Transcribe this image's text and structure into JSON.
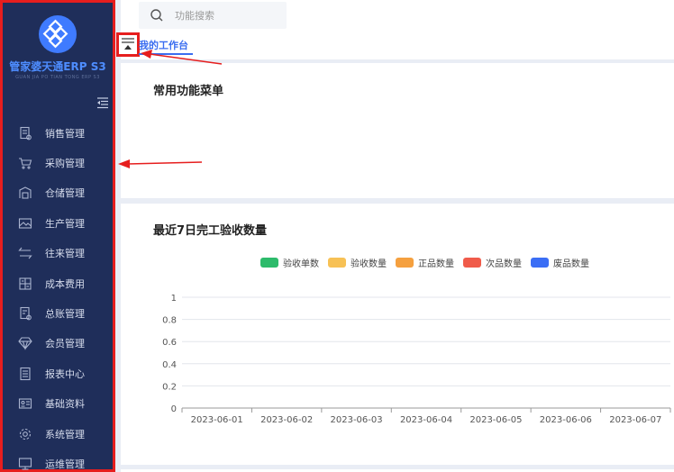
{
  "brand": {
    "name": "管家婆天通ERP S3",
    "subtitle": "GUAN JIA PO TIAN TONG ERP S3"
  },
  "sidebar": {
    "items": [
      {
        "label": "销售管理",
        "icon": "sales-doc-icon"
      },
      {
        "label": "采购管理",
        "icon": "cart-icon"
      },
      {
        "label": "仓储管理",
        "icon": "warehouse-icon"
      },
      {
        "label": "生产管理",
        "icon": "factory-icon"
      },
      {
        "label": "往来管理",
        "icon": "exchange-icon"
      },
      {
        "label": "成本费用",
        "icon": "calculator-icon"
      },
      {
        "label": "总账管理",
        "icon": "ledger-icon"
      },
      {
        "label": "会员管理",
        "icon": "diamond-icon"
      },
      {
        "label": "报表中心",
        "icon": "report-icon"
      },
      {
        "label": "基础资料",
        "icon": "id-card-icon"
      },
      {
        "label": "系统管理",
        "icon": "gear-icon"
      },
      {
        "label": "运维管理",
        "icon": "monitor-icon"
      }
    ]
  },
  "search": {
    "placeholder": "功能搜索"
  },
  "tabs": {
    "active": "我的工作台"
  },
  "sections": {
    "menu_title": "常用功能菜单",
    "chart_title": "最近7日完工验收数量"
  },
  "colors": {
    "sidebar_bg": "#1f2e5a",
    "accent": "#3a6df0",
    "highlight": "#e61e1e"
  },
  "chart_data": {
    "type": "line",
    "title": "最近7日完工验收数量",
    "categories": [
      "2023-06-01",
      "2023-06-02",
      "2023-06-03",
      "2023-06-04",
      "2023-06-05",
      "2023-06-06",
      "2023-06-07"
    ],
    "series": [
      {
        "name": "验收单数",
        "color": "#2dbb6b",
        "values": [
          0,
          0,
          0,
          0,
          0,
          0,
          0
        ]
      },
      {
        "name": "验收数量",
        "color": "#f7c155",
        "values": [
          0,
          0,
          0,
          0,
          0,
          0,
          0
        ]
      },
      {
        "name": "正品数量",
        "color": "#f5a03f",
        "values": [
          0,
          0,
          0,
          0,
          0,
          0,
          0
        ]
      },
      {
        "name": "次品数量",
        "color": "#f05b4a",
        "values": [
          0,
          0,
          0,
          0,
          0,
          0,
          0
        ]
      },
      {
        "name": "废品数量",
        "color": "#3b6ef5",
        "values": [
          0,
          0,
          0,
          0,
          0,
          0,
          0
        ]
      }
    ],
    "yticks": [
      "0",
      "0.2",
      "0.4",
      "0.6",
      "0.8",
      "1"
    ],
    "ylim": [
      0,
      1
    ],
    "grid": true,
    "legend": "top"
  }
}
